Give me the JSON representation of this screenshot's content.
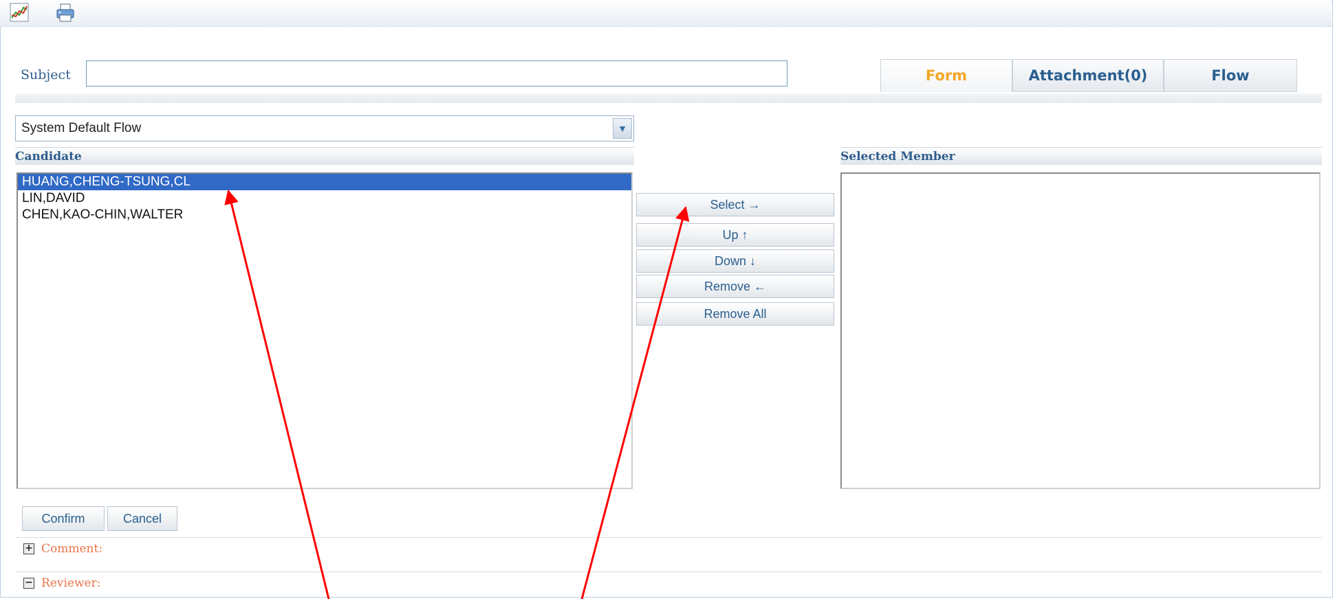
{
  "toolbar": {
    "chart_icon": "chart-icon",
    "print_icon": "printer-icon"
  },
  "subject": {
    "label": "Subject",
    "value": ""
  },
  "tabs": [
    {
      "label": "Form",
      "active": true
    },
    {
      "label": "Attachment(0)",
      "active": false
    },
    {
      "label": "Flow",
      "active": false
    }
  ],
  "flow_select": {
    "selected": "System Default Flow"
  },
  "candidate": {
    "title": "Candidate",
    "items": [
      "HUANG,CHENG-TSUNG,CL",
      "LIN,DAVID",
      "CHEN,KAO-CHIN,WALTER"
    ],
    "selected_index": 0
  },
  "selected_member": {
    "title": "Selected Member",
    "items": []
  },
  "actions": {
    "select": "Select →",
    "up": "Up ↑",
    "down": "Down ↓",
    "remove": "Remove ←",
    "remove_all": "Remove All"
  },
  "footer": {
    "confirm": "Confirm",
    "cancel": "Cancel"
  },
  "sections": {
    "comment": "Comment:",
    "reviewer": "Reviewer:"
  },
  "colors": {
    "accent": "#2a5f8f",
    "active_tab": "#f5a623",
    "selection": "#3169c6",
    "annotation": "#ff0000"
  }
}
